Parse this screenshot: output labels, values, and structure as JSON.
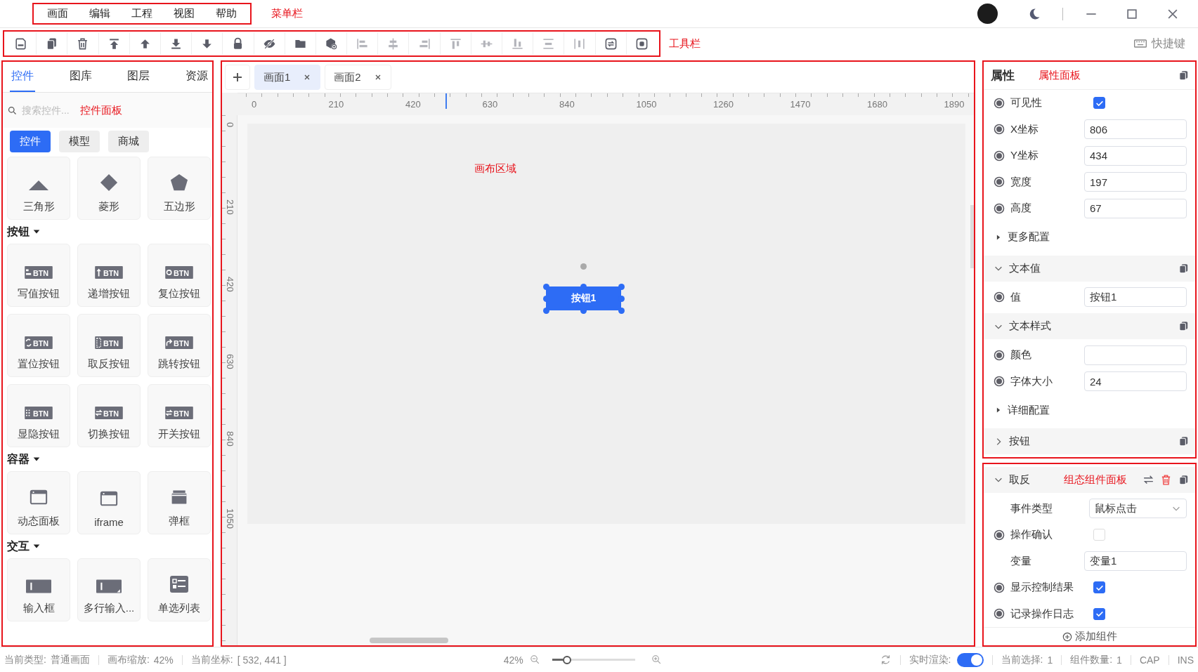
{
  "title_bar": {
    "menu": [
      "画面",
      "编辑",
      "工程",
      "视图",
      "帮助"
    ],
    "menu_note": "菜单栏"
  },
  "toolbar": {
    "items": [
      {
        "kind": "save",
        "disabled": false
      },
      {
        "kind": "copy",
        "disabled": false
      },
      {
        "kind": "delete",
        "disabled": false
      },
      {
        "kind": "top",
        "disabled": false
      },
      {
        "kind": "up",
        "disabled": false
      },
      {
        "kind": "bottom",
        "disabled": false
      },
      {
        "kind": "down",
        "disabled": false
      },
      {
        "kind": "lock",
        "disabled": false
      },
      {
        "kind": "hide",
        "disabled": false
      },
      {
        "kind": "folder",
        "disabled": false
      },
      {
        "kind": "add-component",
        "disabled": false
      },
      {
        "kind": "align-left",
        "disabled": true
      },
      {
        "kind": "align-hcenter",
        "disabled": true
      },
      {
        "kind": "align-right",
        "disabled": true
      },
      {
        "kind": "align-top",
        "disabled": true
      },
      {
        "kind": "align-vcenter",
        "disabled": true
      },
      {
        "kind": "align-bottom",
        "disabled": true
      },
      {
        "kind": "distribute-v",
        "disabled": true
      },
      {
        "kind": "distribute-h",
        "disabled": true
      },
      {
        "kind": "replace",
        "disabled": false
      },
      {
        "kind": "record",
        "disabled": false
      }
    ],
    "note": "工具栏",
    "shortcut": "快捷键"
  },
  "left_panel": {
    "tabs": [
      {
        "label": "控件",
        "selected": true
      },
      {
        "label": "图库",
        "selected": false
      },
      {
        "label": "图层",
        "selected": false
      },
      {
        "label": "资源",
        "selected": false
      }
    ],
    "search": {
      "placeholder": "搜索控件..."
    },
    "note": "控件面板",
    "categories": [
      {
        "label": "控件",
        "selected": true
      },
      {
        "label": "模型",
        "selected": false
      },
      {
        "label": "商城",
        "selected": false
      }
    ],
    "groups": [
      {
        "items": [
          {
            "label": "三角形",
            "kind": "triangle"
          },
          {
            "label": "菱形",
            "kind": "diamond"
          },
          {
            "label": "五边形",
            "kind": "pentagon"
          }
        ]
      },
      {
        "title": "按钮",
        "expanded": true,
        "items": [
          {
            "label": "写值按钮",
            "kind": "write",
            "badge": "BTN"
          },
          {
            "label": "递增按钮",
            "kind": "inc",
            "badge": "BTN"
          },
          {
            "label": "复位按钮",
            "kind": "reset",
            "badge": "BTN"
          },
          {
            "label": "置位按钮",
            "kind": "set",
            "badge": "BTN"
          },
          {
            "label": "取反按钮",
            "kind": "invert",
            "badge": "BTN"
          },
          {
            "label": "跳转按钮",
            "kind": "jump",
            "badge": "BTN"
          },
          {
            "label": "显隐按钮",
            "kind": "showhide",
            "badge": "BTN"
          },
          {
            "label": "切换按钮",
            "kind": "switch",
            "badge": "BTN"
          },
          {
            "label": "开关按钮",
            "kind": "switch",
            "badge": "BTN"
          }
        ]
      },
      {
        "title": "容器",
        "expanded": true,
        "items": [
          {
            "label": "动态面板",
            "kind": "window"
          },
          {
            "label": "iframe",
            "kind": "window"
          },
          {
            "label": "弹框",
            "kind": "dialog"
          }
        ]
      },
      {
        "title": "交互",
        "expanded": true,
        "items": [
          {
            "label": "输入框",
            "kind": "input"
          },
          {
            "label": "多行输入...",
            "kind": "textarea"
          },
          {
            "label": "单选列表",
            "kind": "radio-list"
          }
        ]
      }
    ]
  },
  "canvas": {
    "tabs": [
      {
        "label": "画面1",
        "selected": true
      },
      {
        "label": "画面2",
        "selected": false
      }
    ],
    "h_ruler": [
      "0",
      "210",
      "420",
      "630",
      "840",
      "1050",
      "1260",
      "1470",
      "1680",
      "1890"
    ],
    "v_ruler": [
      "0",
      "210",
      "420",
      "630",
      "840",
      "1050"
    ],
    "note": "画布区域",
    "widget": {
      "label": "按钮1",
      "selected": true
    }
  },
  "properties": {
    "title": "属性",
    "note": "属性面板",
    "rows": [
      {
        "kind": "checkbox",
        "label": "可见性",
        "linked": true,
        "checked": true
      },
      {
        "kind": "input",
        "label": "X坐标",
        "linked": true,
        "value": "806"
      },
      {
        "kind": "input",
        "label": "Y坐标",
        "linked": true,
        "value": "434"
      },
      {
        "kind": "input",
        "label": "宽度",
        "linked": true,
        "value": "197"
      },
      {
        "kind": "input",
        "label": "高度",
        "linked": true,
        "value": "67"
      },
      {
        "kind": "more",
        "label": "更多配置",
        "expanded": false
      },
      {
        "kind": "section",
        "label": "文本值",
        "expanded": true
      },
      {
        "kind": "input",
        "label": "值",
        "linked": true,
        "value": "按钮1"
      },
      {
        "kind": "section",
        "label": "文本样式",
        "expanded": true
      },
      {
        "kind": "input",
        "label": "颜色",
        "linked": true
      },
      {
        "kind": "input",
        "label": "字体大小",
        "linked": true,
        "value": "24"
      },
      {
        "kind": "more",
        "label": "详细配置",
        "expanded": false
      },
      {
        "kind": "section",
        "label": "按钮",
        "expanded": false
      }
    ]
  },
  "component_panel": {
    "title": "取反",
    "expanded": true,
    "note": "组态组件面板",
    "rows": [
      {
        "kind": "select",
        "label": "事件类型",
        "linked": false,
        "value": "鼠标点击"
      },
      {
        "kind": "checkbox",
        "label": "操作确认",
        "linked": true,
        "checked": false
      },
      {
        "kind": "input",
        "label": "变量",
        "linked": false,
        "value": "变量1"
      },
      {
        "kind": "checkbox",
        "label": "显示控制结果",
        "linked": true,
        "checked": true
      },
      {
        "kind": "checkbox",
        "label": "记录操作日志",
        "linked": true,
        "checked": true
      }
    ],
    "add_button": "添加组件"
  },
  "status_bar": {
    "type_label": "当前类型:",
    "type_value": "普通画面",
    "zoom_label": "画布缩放:",
    "zoom_value": "42%",
    "coord_label": "当前坐标:",
    "coord_value": "[ 532, 441 ]",
    "zoom_percent": "42%",
    "zoom": {
      "level": 0.12
    },
    "render_label": "实时渲染:",
    "render_on": true,
    "selection_label": "当前选择:",
    "selection_value": "1",
    "count_label": "组件数量:",
    "count_value": "1",
    "cap": "CAP",
    "ins": "INS"
  }
}
